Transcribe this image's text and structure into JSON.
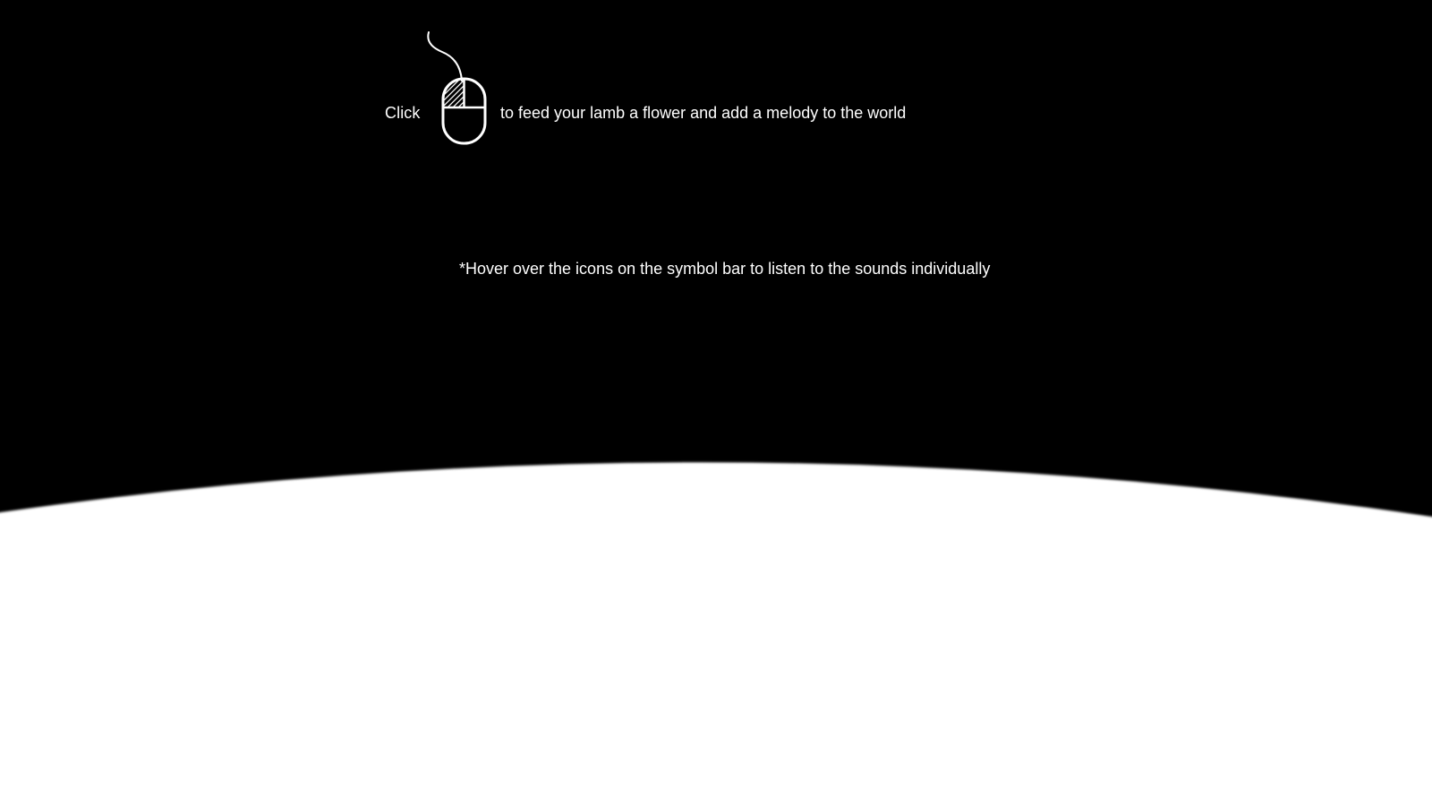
{
  "instructions": {
    "click_word": "Click",
    "action_text": "to feed your lamb a flower and add a melody to the world",
    "hover_hint": "*Hover over the icons on the symbol bar to listen to the sounds individually"
  },
  "icons": {
    "mouse": "mouse-left-click-icon"
  },
  "colors": {
    "background": "#000000",
    "text": "#ffffff",
    "planet": "#ffffff"
  }
}
